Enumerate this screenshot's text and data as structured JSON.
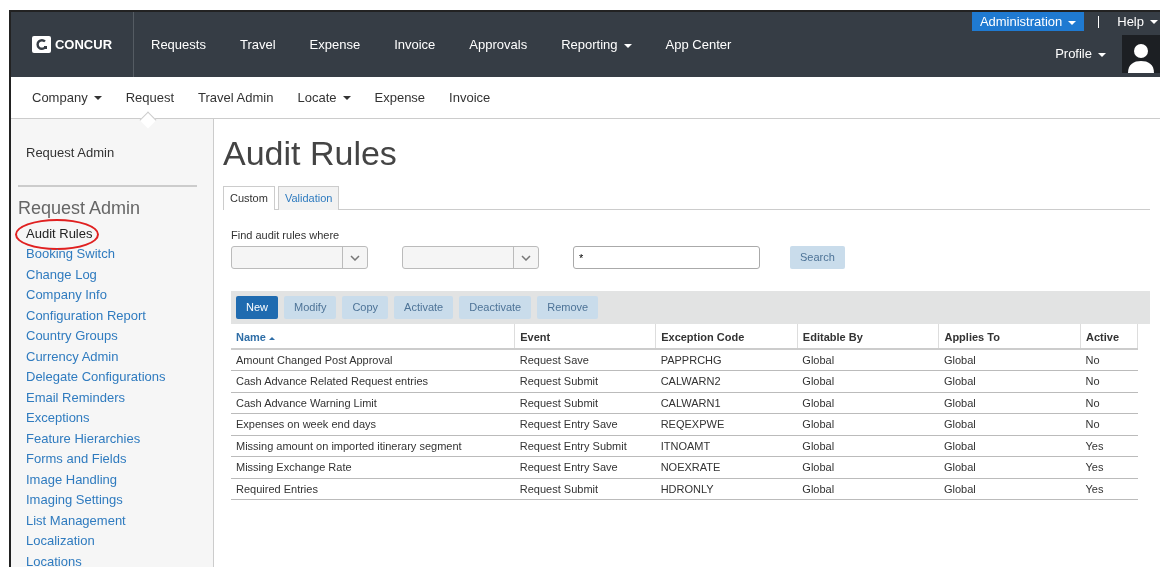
{
  "topnav": {
    "logo": "CONCUR",
    "items": [
      {
        "label": "Requests",
        "dropdown": false
      },
      {
        "label": "Travel",
        "dropdown": false
      },
      {
        "label": "Expense",
        "dropdown": false
      },
      {
        "label": "Invoice",
        "dropdown": false
      },
      {
        "label": "Approvals",
        "dropdown": false
      },
      {
        "label": "Reporting",
        "dropdown": true
      },
      {
        "label": "App Center",
        "dropdown": false
      }
    ],
    "admin": {
      "label": "Administration",
      "dropdown": true
    },
    "help": {
      "label": "Help",
      "dropdown": true
    },
    "profile": {
      "label": "Profile",
      "dropdown": true
    }
  },
  "subnav": [
    {
      "label": "Company",
      "dropdown": true,
      "selected": false
    },
    {
      "label": "Request",
      "dropdown": false,
      "selected": true
    },
    {
      "label": "Travel Admin",
      "dropdown": false,
      "selected": false
    },
    {
      "label": "Locate",
      "dropdown": true,
      "selected": false
    },
    {
      "label": "Expense",
      "dropdown": false,
      "selected": false
    },
    {
      "label": "Invoice",
      "dropdown": false,
      "selected": false
    }
  ],
  "sidebar": {
    "top_link": "Request Admin",
    "heading": "Request Admin",
    "items": [
      {
        "label": "Audit Rules",
        "selected": true
      },
      {
        "label": "Booking Switch",
        "selected": false
      },
      {
        "label": "Change Log",
        "selected": false
      },
      {
        "label": "Company Info",
        "selected": false
      },
      {
        "label": "Configuration Report",
        "selected": false
      },
      {
        "label": "Country Groups",
        "selected": false
      },
      {
        "label": "Currency Admin",
        "selected": false
      },
      {
        "label": "Delegate Configurations",
        "selected": false
      },
      {
        "label": "Email Reminders",
        "selected": false
      },
      {
        "label": "Exceptions",
        "selected": false
      },
      {
        "label": "Feature Hierarchies",
        "selected": false
      },
      {
        "label": "Forms and Fields",
        "selected": false
      },
      {
        "label": "Image Handling",
        "selected": false
      },
      {
        "label": "Imaging Settings",
        "selected": false
      },
      {
        "label": "List Management",
        "selected": false
      },
      {
        "label": "Localization",
        "selected": false
      },
      {
        "label": "Locations",
        "selected": false
      }
    ]
  },
  "page_title": "Audit Rules",
  "tabs": [
    {
      "label": "Custom",
      "selected": true
    },
    {
      "label": "Validation",
      "selected": false
    }
  ],
  "search": {
    "label": "Find audit rules where",
    "value": "*",
    "button": {
      "label": "Search",
      "disabled": true
    }
  },
  "toolbar": [
    {
      "label": "New",
      "disabled": false
    },
    {
      "label": "Modify",
      "disabled": true
    },
    {
      "label": "Copy",
      "disabled": true
    },
    {
      "label": "Activate",
      "disabled": true
    },
    {
      "label": "Deactivate",
      "disabled": true
    },
    {
      "label": "Remove",
      "disabled": true
    }
  ],
  "table": {
    "columns": [
      {
        "label": "Name",
        "sorted": true
      },
      {
        "label": "Event",
        "sorted": false
      },
      {
        "label": "Exception Code",
        "sorted": false
      },
      {
        "label": "Editable By",
        "sorted": false
      },
      {
        "label": "Applies To",
        "sorted": false
      },
      {
        "label": "Active",
        "sorted": false
      }
    ],
    "rows": [
      [
        "Amount Changed Post Approval",
        "Request Save",
        "PAPPRCHG",
        "Global",
        "Global",
        "No"
      ],
      [
        "Cash Advance Related Request entries",
        "Request Submit",
        "CALWARN2",
        "Global",
        "Global",
        "No"
      ],
      [
        "Cash Advance Warning Limit",
        "Request Submit",
        "CALWARN1",
        "Global",
        "Global",
        "No"
      ],
      [
        "Expenses on week end days",
        "Request Entry Save",
        "REQEXPWE",
        "Global",
        "Global",
        "No"
      ],
      [
        "Missing amount on imported itinerary segment",
        "Request Entry Submit",
        "ITNOAMT",
        "Global",
        "Global",
        "Yes"
      ],
      [
        "Missing Exchange Rate",
        "Request Entry Save",
        "NOEXRATE",
        "Global",
        "Global",
        "Yes"
      ],
      [
        "Required Entries",
        "Request Submit",
        "HDRONLY",
        "Global",
        "Global",
        "Yes"
      ]
    ]
  }
}
